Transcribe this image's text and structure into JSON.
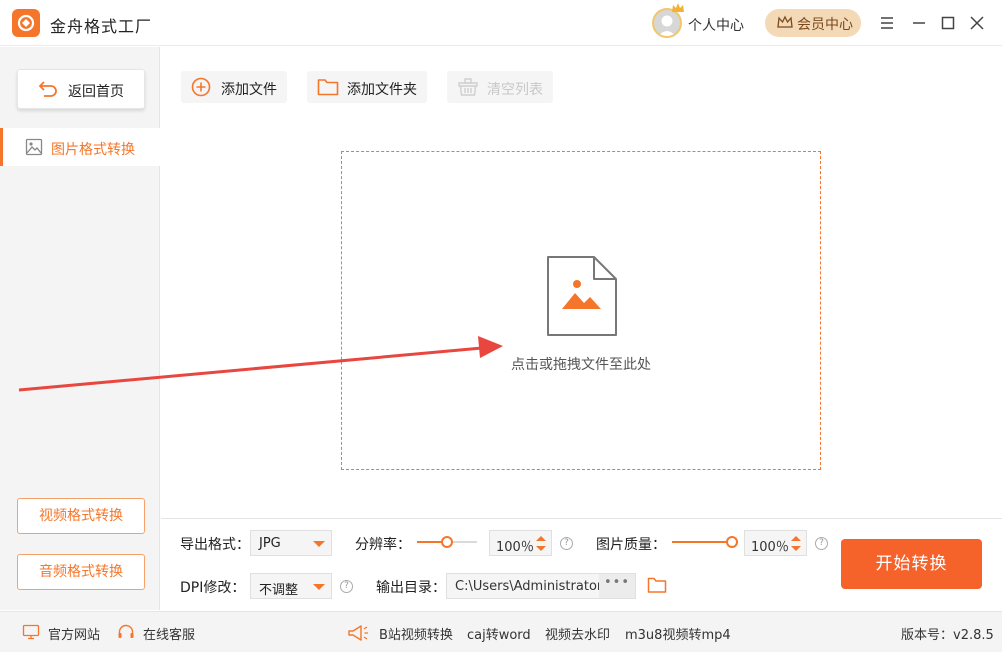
{
  "app": {
    "title": "金舟格式工厂",
    "personal_center": "个人中心",
    "vip_center": "会员中心"
  },
  "sidebar": {
    "home_button": "返回首页",
    "active_item": "图片格式转换",
    "video_button": "视频格式转换",
    "audio_button": "音频格式转换"
  },
  "toolbar": {
    "add_file": "添加文件",
    "add_folder": "添加文件夹",
    "clear_list": "清空列表"
  },
  "dropzone": {
    "hint": "点击或拖拽文件至此处"
  },
  "settings": {
    "export_format_label": "导出格式：",
    "export_format_value": "JPG",
    "resolution_label": "分辨率：",
    "resolution_value": "100％",
    "resolution_level": 0.5,
    "quality_label": "图片质量：",
    "quality_value": "100％",
    "quality_level": 1.0,
    "dpi_label": "DPI修改：",
    "dpi_value": "不调整",
    "output_dir_label": "输出目录：",
    "output_dir_value": "C:\\Users\\Administrator\\De",
    "output_dir_more": "•••",
    "start_button": "开始转换"
  },
  "statusbar": {
    "website": "官方网站",
    "support": "在线客服",
    "link_bilibili": "B站视频转换",
    "link_caj": "caj转word",
    "link_watermark": "视频去水印",
    "link_m3u8": "m3u8视频转mp4",
    "version": "版本号：v2.8.5"
  },
  "colors": {
    "accent": "#f5762a",
    "start_button": "#f5622a",
    "vip_bg": "#f3d9b6",
    "annotation_arrow": "#e8463f"
  },
  "icons": {
    "logo": "app-logo-icon",
    "home": "return-arrow-icon",
    "image": "image-icon",
    "add": "plus-circle-icon",
    "folder": "folder-icon",
    "clear": "trash-basket-icon",
    "drop": "image-file-icon",
    "help": "question-circle-icon",
    "website": "monitor-icon",
    "support": "headset-icon",
    "announce": "megaphone-icon",
    "minimize": "minimize-icon",
    "maximize": "maximize-icon",
    "close": "close-icon",
    "menu": "hamburger-menu-icon",
    "crown": "crown-icon"
  }
}
